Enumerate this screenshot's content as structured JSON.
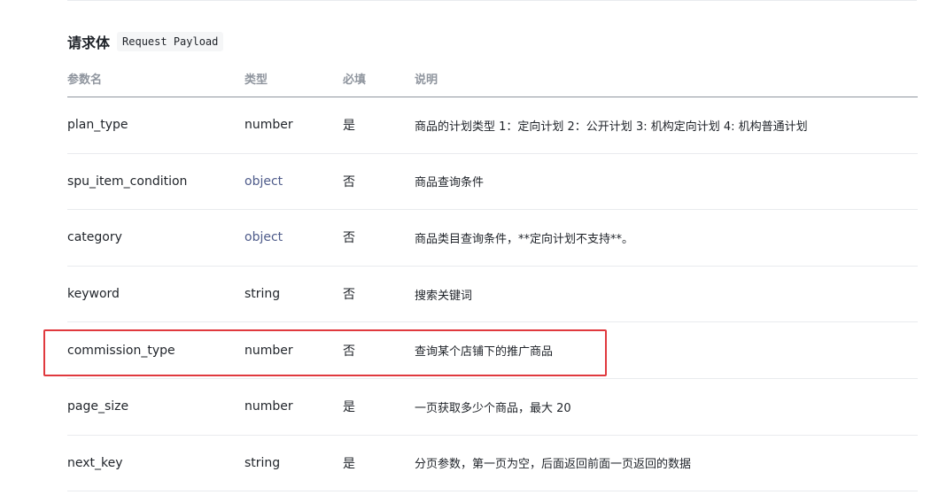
{
  "section": {
    "title": "请求体",
    "badge": "Request Payload"
  },
  "table": {
    "headers": {
      "name": "参数名",
      "type": "类型",
      "required": "必填",
      "description": "说明"
    },
    "rows": [
      {
        "name": "plan_type",
        "type": "number",
        "type_is_link": false,
        "required": "是",
        "description": "商品的计划类型 1：定向计划 2：公开计划 3: 机构定向计划 4: 机构普通计划"
      },
      {
        "name": "spu_item_condition",
        "type": "object",
        "type_is_link": true,
        "required": "否",
        "description": "商品查询条件"
      },
      {
        "name": "category",
        "type": "object",
        "type_is_link": true,
        "required": "否",
        "description": "商品类目查询条件，**定向计划不支持**。"
      },
      {
        "name": "keyword",
        "type": "string",
        "type_is_link": false,
        "required": "否",
        "description": "搜索关键词"
      },
      {
        "name": "commission_type",
        "type": "number",
        "type_is_link": false,
        "required": "否",
        "description": "查询某个店铺下的推广商品"
      },
      {
        "name": "page_size",
        "type": "number",
        "type_is_link": false,
        "required": "是",
        "description": "一页获取多少个商品，最大 20"
      },
      {
        "name": "next_key",
        "type": "string",
        "type_is_link": false,
        "required": "是",
        "description": "分页参数，第一页为空，后面返回前面一页返回的数据"
      }
    ]
  },
  "highlight": {
    "row_name": "commission_type",
    "color": "#e0393e"
  },
  "colors": {
    "link": "#4e5b8a",
    "header_text": "#8f959e",
    "body_text": "#1f2329"
  }
}
